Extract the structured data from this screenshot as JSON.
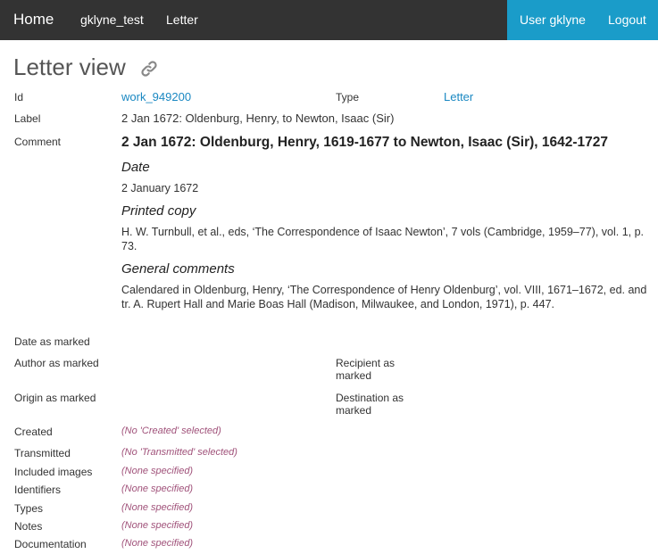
{
  "nav": {
    "home": "Home",
    "collection": "gklyne_test",
    "letter": "Letter",
    "user": "User gklyne",
    "logout": "Logout"
  },
  "page": {
    "title": "Letter view",
    "permalink_icon": "link-icon"
  },
  "fields": {
    "id_label": "Id",
    "id_value": "work_949200",
    "type_label": "Type",
    "type_value": "Letter",
    "label_label": "Label",
    "label_value": "2 Jan 1672: Oldenburg, Henry, to Newton, Isaac (Sir)",
    "comment_label": "Comment",
    "date_as_marked_label": "Date as marked",
    "author_as_marked_label": "Author as marked",
    "recipient_as_marked_label": "Recipient as marked",
    "origin_as_marked_label": "Origin as marked",
    "destination_as_marked_label": "Destination as marked",
    "created_label": "Created",
    "created_value": "(No 'Created' selected)",
    "transmitted_label": "Transmitted",
    "transmitted_value": "(No 'Transmitted' selected)",
    "included_images_label": "Included images",
    "included_images_value": "(None specified)",
    "identifiers_label": "Identifiers",
    "identifiers_value": "(None specified)",
    "types_label": "Types",
    "types_value": "(None specified)",
    "notes_label": "Notes",
    "notes_value": "(None specified)",
    "documentation_label": "Documentation",
    "documentation_value": "(None specified)"
  },
  "comment": {
    "title": "2 Jan 1672: Oldenburg, Henry, 1619-1677 to Newton, Isaac (Sir), 1642-1727",
    "date_heading": "Date",
    "date_text": "2 January 1672",
    "printed_heading": "Printed copy",
    "printed_text": "H. W. Turnbull, et al., eds, ‘The Correspondence of Isaac Newton’, 7 vols (Cambridge, 1959–77), vol. 1, p. 73.",
    "general_heading": "General comments",
    "general_text": "Calendared in Oldenburg, Henry, ‘The Correspondence of Henry Oldenburg’, vol. VIII, 1671–1672, ed. and tr. A. Rupert Hall and Marie Boas Hall (Madison, Milwaukee, and London, 1971), p. 447."
  },
  "colors": {
    "navbar": "#333333",
    "accent": "#1a9cc9",
    "link": "#1a88c2",
    "empty_value": "#a0527a"
  }
}
